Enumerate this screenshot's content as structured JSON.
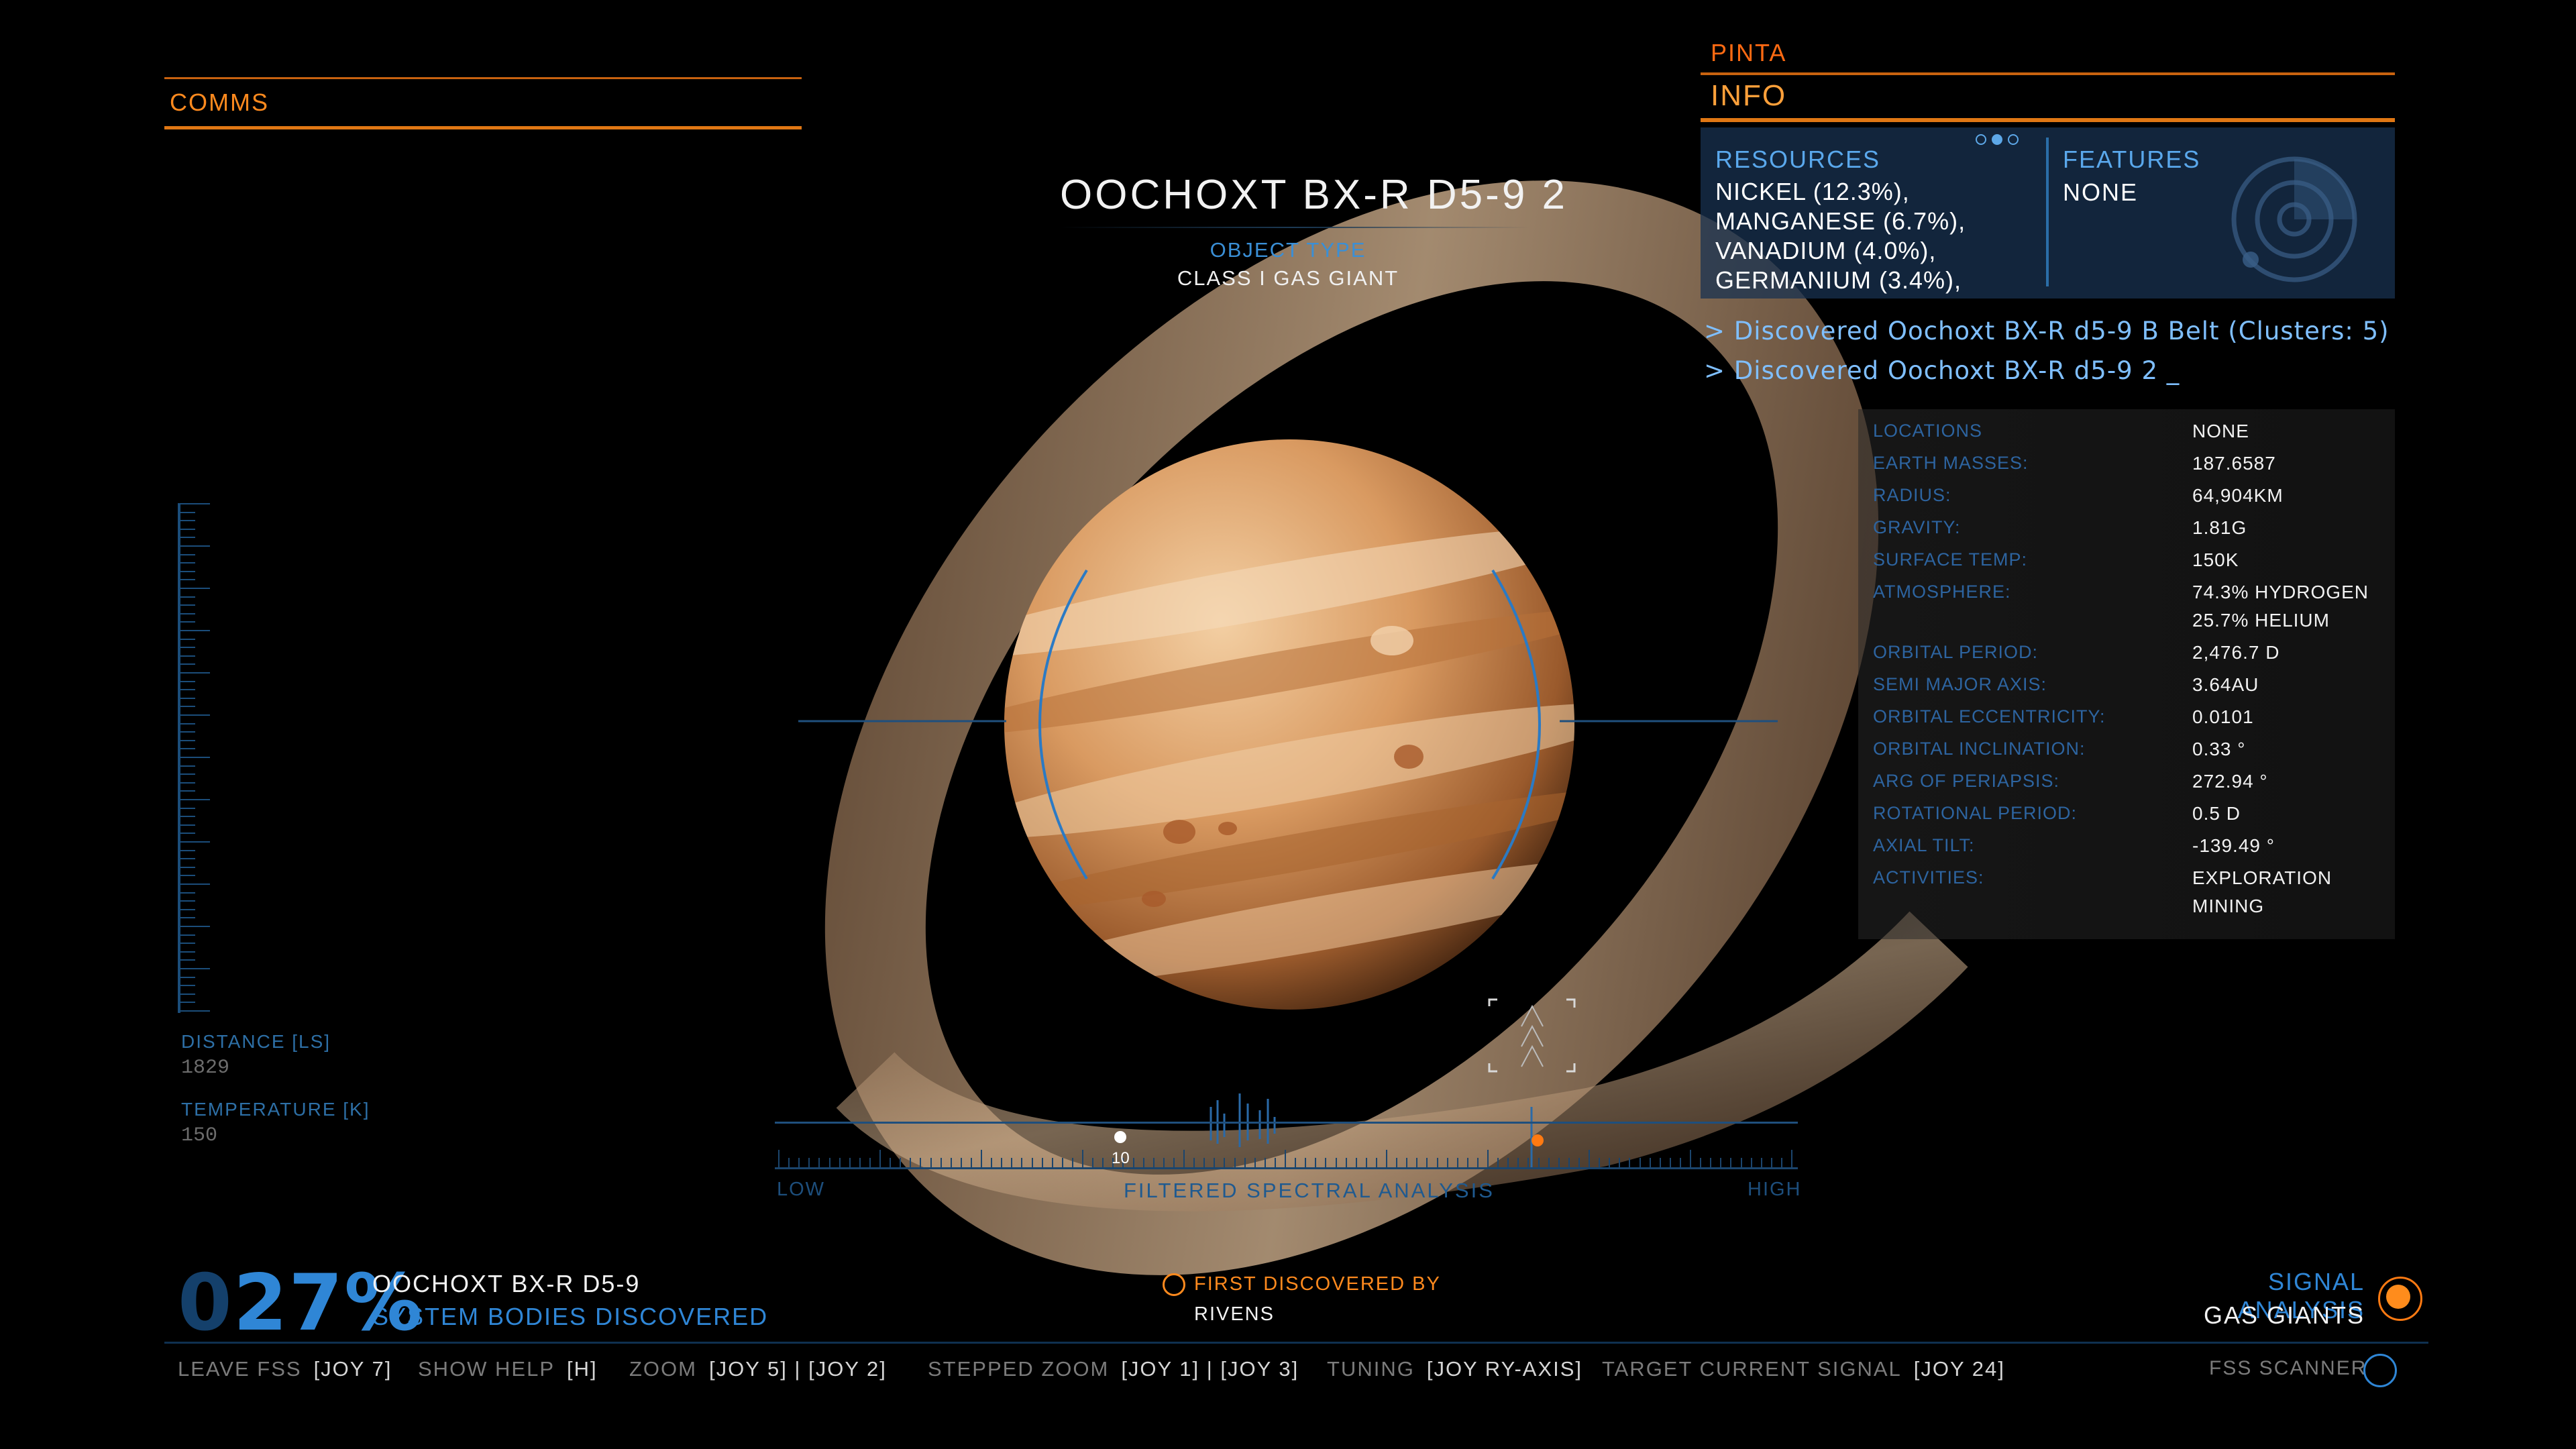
{
  "comms": {
    "label": "COMMS"
  },
  "left_readouts": {
    "distance_label": "DISTANCE [LS]",
    "distance_value": "1829",
    "temperature_label": "TEMPERATURE [K]",
    "temperature_value": "150"
  },
  "body": {
    "name": "OOCHOXT BX-R D5-9 2",
    "object_type_label": "OBJECT TYPE",
    "object_type_value": "CLASS I GAS GIANT"
  },
  "info_panel": {
    "ship_name": "PINTA",
    "title": "INFO",
    "page_dots": [
      false,
      true,
      false
    ],
    "resources_label": "RESOURCES",
    "resources": [
      "NICKEL (12.3%),",
      "MANGANESE (6.7%),",
      "VANADIUM (4.0%),",
      "GERMANIUM (3.4%),"
    ],
    "features_label": "FEATURES",
    "features_value": "NONE"
  },
  "discovery_log": [
    "> Discovered Oochoxt BX-R d5-9 B Belt (Clusters: 5)",
    "> Discovered Oochoxt BX-R d5-9 2 _"
  ],
  "body_data": [
    {
      "key": "LOCATIONS",
      "value": "NONE"
    },
    {
      "key": "EARTH MASSES:",
      "value": "187.6587"
    },
    {
      "key": "RADIUS:",
      "value": "64,904KM"
    },
    {
      "key": "GRAVITY:",
      "value": "1.81G"
    },
    {
      "key": "SURFACE TEMP:",
      "value": "150K"
    },
    {
      "key": "ATMOSPHERE:",
      "value": "74.3% HYDROGEN",
      "value2": "25.7% HELIUM"
    },
    {
      "key": "ORBITAL PERIOD:",
      "value": "2,476.7 D"
    },
    {
      "key": "SEMI MAJOR AXIS:",
      "value": "3.64AU"
    },
    {
      "key": "ORBITAL ECCENTRICITY:",
      "value": "0.0101"
    },
    {
      "key": "ORBITAL INCLINATION:",
      "value": "0.33 °"
    },
    {
      "key": "ARG OF PERIAPSIS:",
      "value": "272.94 °"
    },
    {
      "key": "ROTATIONAL PERIOD:",
      "value": "0.5 D"
    },
    {
      "key": "AXIAL TILT:",
      "value": "-139.49 °"
    },
    {
      "key": "ACTIVITIES:",
      "value": "EXPLORATION",
      "value2": "MINING"
    }
  ],
  "spectral": {
    "low_label": "LOW",
    "high_label": "HIGH",
    "title": "FILTERED SPECTRAL ANALYSIS",
    "marker_value": "10"
  },
  "system": {
    "percent_dim": "0",
    "percent": "27%",
    "name": "OOCHOXT BX-R D5-9",
    "bodies_label": "SYSTEM BODIES DISCOVERED"
  },
  "first_discovered": {
    "label": "FIRST DISCOVERED BY",
    "value": "RIVENS"
  },
  "signal": {
    "label": "SIGNAL ANALYSIS",
    "value": "GAS GIANTS"
  },
  "controls": [
    {
      "key": "LEAVE FSS",
      "value": "[JOY 7]"
    },
    {
      "key": "SHOW HELP",
      "value": "[H]"
    },
    {
      "key": "ZOOM",
      "value": "[JOY 5] | [JOY 2]"
    },
    {
      "key": "STEPPED ZOOM",
      "value": "[JOY 1] | [JOY 3]"
    },
    {
      "key": "TUNING",
      "value": "[JOY RY-AXIS]"
    },
    {
      "key": "TARGET CURRENT SIGNAL",
      "value": "[JOY 24]"
    }
  ],
  "fss_scanner": {
    "label": "FSS SCANNER"
  },
  "colors": {
    "accent_orange": "#ff8a1e",
    "accent_blue": "#2f86d6",
    "background": "#000000"
  }
}
